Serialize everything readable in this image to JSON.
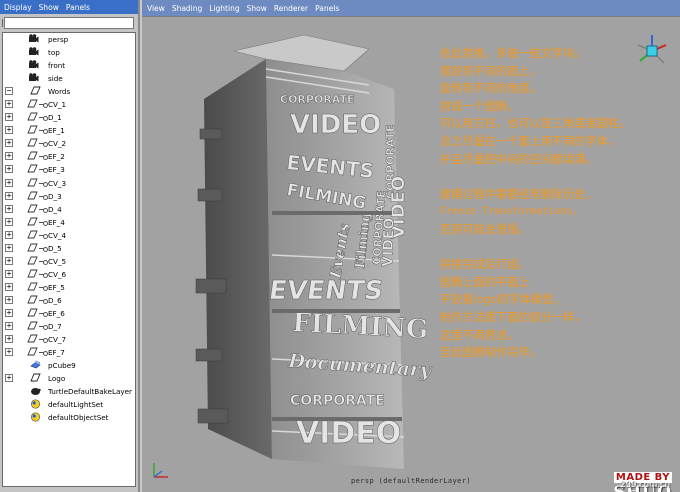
{
  "outliner": {
    "menu": [
      "Display",
      "Show",
      "Panels"
    ],
    "search_value": "",
    "items": [
      {
        "label": "persp",
        "kind": "camera",
        "expandable": false
      },
      {
        "label": "top",
        "kind": "camera",
        "expandable": false
      },
      {
        "label": "front",
        "kind": "camera",
        "expandable": false
      },
      {
        "label": "side",
        "kind": "camera",
        "expandable": false
      },
      {
        "label": "Words",
        "kind": "group",
        "expandable": true,
        "expanded": true
      },
      {
        "label": "CV_1",
        "kind": "curve",
        "expandable": true
      },
      {
        "label": "D_1",
        "kind": "curve",
        "expandable": true
      },
      {
        "label": "EF_1",
        "kind": "curve",
        "expandable": true
      },
      {
        "label": "CV_2",
        "kind": "curve",
        "expandable": true
      },
      {
        "label": "EF_2",
        "kind": "curve",
        "expandable": true
      },
      {
        "label": "EF_3",
        "kind": "curve",
        "expandable": true
      },
      {
        "label": "CV_3",
        "kind": "curve",
        "expandable": true
      },
      {
        "label": "D_3",
        "kind": "curve",
        "expandable": true
      },
      {
        "label": "D_4",
        "kind": "curve",
        "expandable": true
      },
      {
        "label": "EF_4",
        "kind": "curve",
        "expandable": true
      },
      {
        "label": "CV_4",
        "kind": "curve",
        "expandable": true
      },
      {
        "label": "D_5",
        "kind": "curve",
        "expandable": true
      },
      {
        "label": "CV_5",
        "kind": "curve",
        "expandable": true
      },
      {
        "label": "CV_6",
        "kind": "curve",
        "expandable": true
      },
      {
        "label": "EF_5",
        "kind": "curve",
        "expandable": true
      },
      {
        "label": "D_6",
        "kind": "curve",
        "expandable": true
      },
      {
        "label": "EF_6",
        "kind": "curve",
        "expandable": true
      },
      {
        "label": "D_7",
        "kind": "curve",
        "expandable": true
      },
      {
        "label": "CV_7",
        "kind": "curve",
        "expandable": true
      },
      {
        "label": "EF_7",
        "kind": "curve",
        "expandable": true
      },
      {
        "label": "pCube9",
        "kind": "mesh",
        "expandable": false
      },
      {
        "label": "Logo",
        "kind": "group",
        "expandable": true,
        "expanded": false
      },
      {
        "label": "TurtleDefaultBakeLayer",
        "kind": "turtle",
        "expandable": false
      },
      {
        "label": "defaultLightSet",
        "kind": "set",
        "expandable": false
      },
      {
        "label": "defaultObjectSet",
        "kind": "set",
        "expandable": false
      }
    ]
  },
  "viewport": {
    "menu": [
      "View",
      "Shading",
      "Lighting",
      "Show",
      "Renderer",
      "Panels"
    ],
    "camera_label": "persp (defaultRenderLayer)",
    "tower_words": [
      "CORPORATE",
      "VIDEO",
      "EVENTS",
      "FILMING",
      "CORPORATE",
      "VIDEO",
      "Events",
      "Filming",
      "CORPORATE",
      "VIDEO",
      "EVENTS",
      "FILMING",
      "Documentary",
      "CORPORATE",
      "VIDEO"
    ],
    "notes": [
      "依此类推，多做一些文字块。",
      "摆放到不同的面上，",
      "旋转到不同的角度。",
      "拼成一个图腾。",
      "可以用方柱，也可以是三角或者圆柱。",
      "总之尽量在一个面上用不同的字体，",
      "并且尽量把中间的空间都填满。",
      "",
      "建模过程中需要经常删除历史，",
      "Freeze Transformations,",
      "否则可能会很慢。",
      "",
      "拼接完成后打组。",
      "图腾上面的平面上",
      "平放着logo的字体模型，",
      "制作方法跟下面的部分一样，",
      "这里不再赘述。",
      "至此图腾制作完毕。"
    ],
    "stamp_made_by": "MADE BY",
    "stamp_name": "SHUO",
    "watermark": "299.com.cn"
  },
  "colors": {
    "outliner_menubar": "#3a6fc7",
    "viewport_menubar": "#6d8bc0",
    "viewport_bg": "#a2a2a2",
    "note_text": "#f39a1f",
    "stamp_red": "#b01010"
  }
}
